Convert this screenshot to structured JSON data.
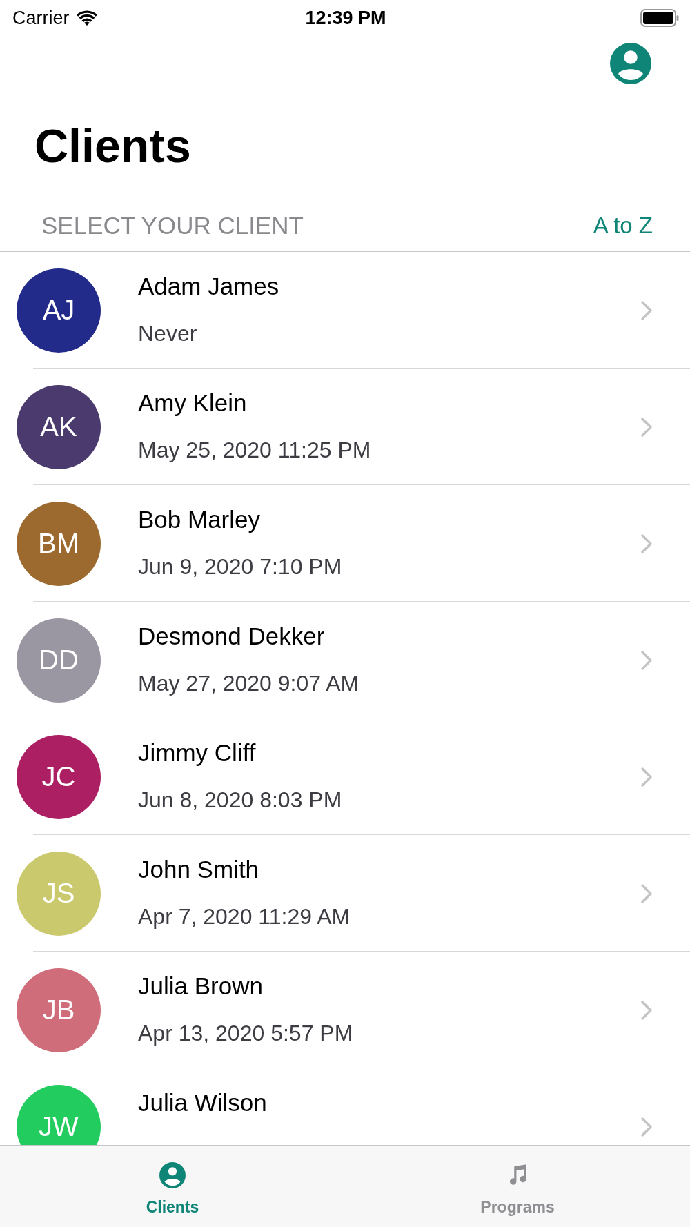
{
  "status_bar": {
    "carrier": "Carrier",
    "time": "12:39 PM"
  },
  "title": "Clients",
  "section": {
    "header": "SELECT YOUR CLIENT",
    "sort": "A to Z"
  },
  "clients": [
    {
      "initials": "AJ",
      "name": "Adam James",
      "last_seen": "Never",
      "color": "#222a8a"
    },
    {
      "initials": "AK",
      "name": "Amy Klein",
      "last_seen": "May 25, 2020 11:25 PM",
      "color": "#4b3a6e"
    },
    {
      "initials": "BM",
      "name": "Bob Marley",
      "last_seen": "Jun 9, 2020 7:10 PM",
      "color": "#9c6a2e"
    },
    {
      "initials": "DD",
      "name": "Desmond Dekker",
      "last_seen": "May 27, 2020 9:07 AM",
      "color": "#9a97a3"
    },
    {
      "initials": "JC",
      "name": "Jimmy Cliff",
      "last_seen": "Jun 8, 2020 8:03 PM",
      "color": "#ad1f63"
    },
    {
      "initials": "JS",
      "name": "John Smith",
      "last_seen": "Apr 7, 2020 11:29 AM",
      "color": "#cbc96e"
    },
    {
      "initials": "JB",
      "name": "Julia Brown",
      "last_seen": "Apr 13, 2020 5:57 PM",
      "color": "#cf6d7a"
    },
    {
      "initials": "JW",
      "name": "Julia Wilson",
      "color": "#22cc5e"
    }
  ],
  "tabs": [
    {
      "label": "Clients",
      "kind": "person",
      "selected": true
    },
    {
      "label": "Programs",
      "kind": "music",
      "selected": false
    }
  ]
}
